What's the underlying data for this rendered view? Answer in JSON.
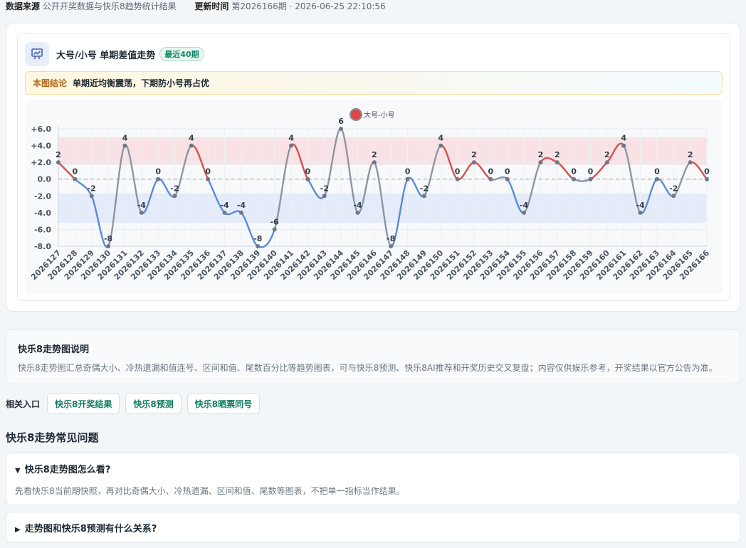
{
  "meta": {
    "source_label": "数据来源",
    "source_value": "公开开奖数据与快乐8趋势统计结果",
    "update_label": "更新时间",
    "update_value": "第2026166期 · 2026-06-25 22:10:56"
  },
  "chart_card": {
    "title": "大号/小号 单期差值走势",
    "badge": "最近40期",
    "conclusion_label": "本图结论",
    "conclusion_text": "单期近均衡震荡，下期防小号再占优"
  },
  "chart_data": {
    "type": "line",
    "title": "大号/小号 单期差值走势",
    "legend": "大号-小号",
    "legend_position": "top-center",
    "x": [
      "2026127",
      "2026128",
      "2026129",
      "2026130",
      "2026131",
      "2026132",
      "2026133",
      "2026134",
      "2026135",
      "2026136",
      "2026137",
      "2026138",
      "2026139",
      "2026140",
      "2026141",
      "2026142",
      "2026143",
      "2026144",
      "2026145",
      "2026146",
      "2026147",
      "2026148",
      "2026149",
      "2026150",
      "2026151",
      "2026152",
      "2026153",
      "2026154",
      "2026155",
      "2026156",
      "2026157",
      "2026158",
      "2026159",
      "2026160",
      "2026161",
      "2026162",
      "2026163",
      "2026164",
      "2026165",
      "2026166"
    ],
    "values": [
      2,
      0,
      -2,
      -8,
      4,
      -4,
      0,
      -2,
      4,
      0,
      -4,
      -4,
      -8,
      -6,
      4,
      0,
      -2,
      6,
      -4,
      2,
      -8,
      0,
      -2,
      4,
      0,
      2,
      0,
      0,
      -4,
      2,
      2,
      0,
      0,
      2,
      4,
      -4,
      0,
      -2,
      2,
      0
    ],
    "y_ticks": [
      "+6.0",
      "+4.0",
      "+2.0",
      "0.0",
      "-2.0",
      "-4.0",
      "-6.0",
      "-8.0"
    ],
    "ylim": [
      -8,
      6
    ],
    "bands": [
      {
        "from": 1.7,
        "to": 5.0,
        "color": "#f9d9dd"
      },
      {
        "from": -5.2,
        "to": -1.7,
        "color": "#dde6fb"
      }
    ],
    "colors": {
      "positive": "#d6504e",
      "negative": "#5a8ad8",
      "neutral": "#8c96a3",
      "zero_line": "#9aa3ad",
      "legend_dot": "#d94848"
    },
    "grid": true
  },
  "desc": {
    "title": "快乐8走势图说明",
    "text": "快乐8走势图汇总奇偶大小、冷热遗漏和值连号、区间和值、尾数百分比等趋势图表，可与快乐8预测、快乐8AI推荐和开奖历史交叉复盘；内容仅供娱乐参考，开奖结果以官方公告为准。"
  },
  "links": {
    "label": "相关入口",
    "items": [
      "快乐8开奖结果",
      "快乐8预测",
      "快乐8晒票同号"
    ]
  },
  "faq": {
    "title": "快乐8走势常见问题",
    "items": [
      {
        "q": "快乐8走势图怎么看?",
        "a": "先看快乐8当前期快照，再对比奇偶大小、冷热遗漏、区间和值、尾数等图表，不把单一指标当作结果。",
        "open": true
      },
      {
        "q": "走势图和快乐8预测有什么关系?",
        "a": "",
        "open": false
      }
    ]
  }
}
